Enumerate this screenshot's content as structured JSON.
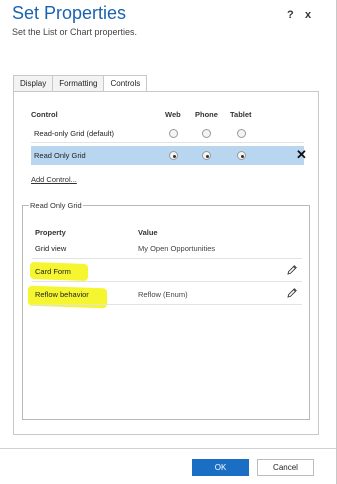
{
  "dialog": {
    "title": "Set Properties",
    "subtitle": "Set the List or Chart properties.",
    "help_label": "?",
    "close_label": "x"
  },
  "tabs": [
    {
      "label": "Display",
      "active": false
    },
    {
      "label": "Formatting",
      "active": false
    },
    {
      "label": "Controls",
      "active": true
    }
  ],
  "controls": {
    "headers": {
      "control": "Control",
      "web": "Web",
      "phone": "Phone",
      "tablet": "Tablet"
    },
    "rows": [
      {
        "label": "Read-only Grid (default)",
        "web": false,
        "phone": false,
        "tablet": false,
        "selected": false
      },
      {
        "label": "Read Only Grid",
        "web": true,
        "phone": true,
        "tablet": true,
        "selected": true
      }
    ],
    "remove_label": "✕",
    "add_link": "Add Control..."
  },
  "property_group": {
    "title": "Read Only Grid",
    "headers": {
      "property": "Property",
      "value": "Value"
    },
    "rows": [
      {
        "name": "Grid view",
        "value": "My Open Opportunities",
        "editable": false,
        "highlighted": false
      },
      {
        "name": "Card Form",
        "value": "",
        "editable": true,
        "highlighted": true
      },
      {
        "name": "Reflow behavior",
        "value": "Reflow (Enum)",
        "editable": true,
        "highlighted": true
      }
    ],
    "highlight_color": "#f4f41a"
  },
  "footer": {
    "ok_label": "OK",
    "cancel_label": "Cancel"
  },
  "colors": {
    "title": "#1a62b0",
    "selected_row": "#b9d6f0",
    "ok_button": "#1a6fc4"
  }
}
